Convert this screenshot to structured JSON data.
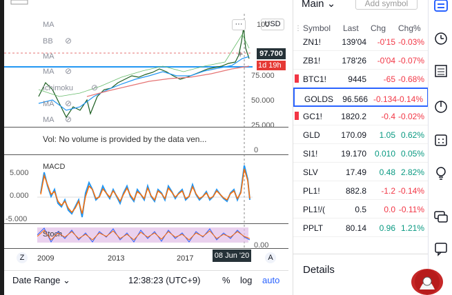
{
  "chart": {
    "indicators": {
      "ma1": "MA",
      "bb": "BB",
      "ma2": "MA",
      "ma3": "MA",
      "ichimoku": "Ichimoku",
      "ma4": "MA",
      "ma5": "MA"
    },
    "price_axis": [
      "100",
      "75.000",
      "50.000",
      "25.000",
      "0"
    ],
    "current_price": "97.700",
    "countdown": "1d 19h",
    "currency": "USD",
    "volume_note": "Vol: No volume is provided by the data ven...",
    "macd_label": "MACD",
    "macd_axis": [
      "5.000",
      "0.000",
      "-5.000"
    ],
    "stoch_label": "Stoch",
    "stoch_axis": [
      "0.00"
    ],
    "time_axis": [
      "2009",
      "2013",
      "2017"
    ],
    "crosshair_date": "08 Jun '20",
    "z_label": "Z",
    "a_label": "A"
  },
  "bottom_bar": {
    "date_range": "Date Range",
    "time": "12:38:23 (UTC+9)",
    "percent": "%",
    "log": "log",
    "auto": "auto"
  },
  "watchlist": {
    "title": "Main",
    "add_symbol": "Add symbol",
    "headers": {
      "symbol": "Symbol",
      "last": "Last",
      "chg": "Chg",
      "pct": "Chg%"
    },
    "rows": [
      {
        "symbol": "ZN1!",
        "last": "139'04",
        "chg": "-0'15",
        "pct": "-0.03%",
        "dir": "down"
      },
      {
        "symbol": "ZB1!",
        "last": "178'26",
        "chg": "-0'04",
        "pct": "-0.07%",
        "dir": "down"
      },
      {
        "symbol": "BTC1!",
        "last": "9445",
        "chg": "-65",
        "pct": "-0.68%",
        "dir": "down"
      },
      {
        "symbol": "GOLDS",
        "last": "96.566",
        "chg": "-0.134",
        "pct": "-0.14%",
        "dir": "down"
      },
      {
        "symbol": "GC1!",
        "last": "1820.2",
        "chg": "-0.4",
        "pct": "-0.02%",
        "dir": "down"
      },
      {
        "symbol": "GLD",
        "last": "170.09",
        "chg": "1.05",
        "pct": "0.62%",
        "dir": "up"
      },
      {
        "symbol": "SI1!",
        "last": "19.170",
        "chg": "0.010",
        "pct": "0.05%",
        "dir": "up"
      },
      {
        "symbol": "SLV",
        "last": "17.49",
        "chg": "0.48",
        "pct": "2.82%",
        "dir": "up"
      },
      {
        "symbol": "PL1!",
        "last": "882.8",
        "chg": "-1.2",
        "pct": "-0.14%",
        "dir": "down"
      },
      {
        "symbol": "PL1!/(",
        "last": "0.5",
        "chg": "0.0",
        "pct": "-0.11%",
        "dir": "down"
      },
      {
        "symbol": "PPLT",
        "last": "80.14",
        "chg": "0.96",
        "pct": "1.21%",
        "dir": "up"
      }
    ],
    "details": "Details"
  },
  "colors": {
    "accent": "#2962ff",
    "up": "#089981",
    "down": "#f23645",
    "macd": "#2196f3",
    "signal": "#ff6d00"
  }
}
